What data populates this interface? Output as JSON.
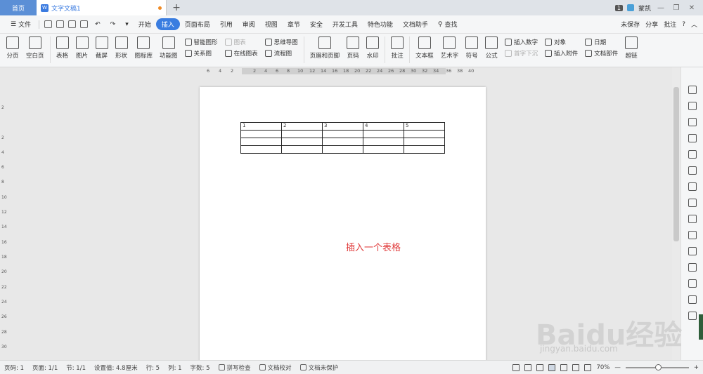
{
  "tabbar": {
    "home": "首页",
    "doc_title": "文字文稿1",
    "doc_icon": "W",
    "plus": "+",
    "page_count": "1",
    "user": "蒙凯"
  },
  "menubar": {
    "file": "文件",
    "tabs": [
      "开始",
      "插入",
      "页面布局",
      "引用",
      "审阅",
      "视图",
      "章节",
      "安全",
      "开发工具",
      "特色功能",
      "文档助手"
    ],
    "active_tab": "插入",
    "search": "查找",
    "unsaved": "未保存",
    "share": "分享",
    "annotate": "批注",
    "help": "?"
  },
  "ribbon": {
    "big1": [
      "分页",
      "空白页",
      "表格",
      "图片",
      "截屏",
      "形状",
      "图标库",
      "功能图"
    ],
    "col_a": [
      "智能图形",
      "关系图"
    ],
    "col_b": [
      "图表",
      "在线图表"
    ],
    "col_c": [
      "思维导图",
      "流程图"
    ],
    "big2": [
      "页眉和页脚",
      "页码",
      "水印",
      "批注",
      "文本框",
      "艺术字",
      "符号",
      "公式"
    ],
    "col_d": [
      "插入数字",
      "首字下沉"
    ],
    "col_e": [
      "对象",
      "插入附件"
    ],
    "col_f": [
      "日期",
      "文档部件"
    ],
    "last": "超链"
  },
  "ruler": {
    "h": [
      "6",
      "4",
      "2",
      "2",
      "4",
      "6",
      "8",
      "10",
      "12",
      "14",
      "16",
      "18",
      "20",
      "22",
      "24",
      "26",
      "28",
      "30",
      "32",
      "34",
      "36",
      "38",
      "40"
    ],
    "v": [
      "2",
      "2",
      "4",
      "6",
      "8",
      "10",
      "12",
      "14",
      "16",
      "18",
      "20",
      "22",
      "24",
      "26",
      "28",
      "30"
    ]
  },
  "document": {
    "table": [
      [
        "1",
        "2",
        "3",
        "4",
        "5"
      ],
      [
        "",
        "",
        "",
        "",
        ""
      ],
      [
        "",
        "",
        "",
        "",
        ""
      ],
      [
        "",
        "",
        "",
        "",
        ""
      ]
    ],
    "note": "插入一个表格",
    "note_color": "#e03a3a"
  },
  "statusbar": {
    "page_no": "页码: 1",
    "pages": "页面: 1/1",
    "section": "节: 1/1",
    "setting": "设置值: 4.8厘米",
    "row": "行: 5",
    "col": "列: 1",
    "words": "字数: 5",
    "spell": "拼写检查",
    "proof": "文档校对",
    "protect": "文档未保护",
    "zoom": "70%",
    "minus": "—",
    "plus": "+"
  },
  "watermark": {
    "main": "Baidu经验",
    "sub": "jingyan.baidu.com"
  }
}
